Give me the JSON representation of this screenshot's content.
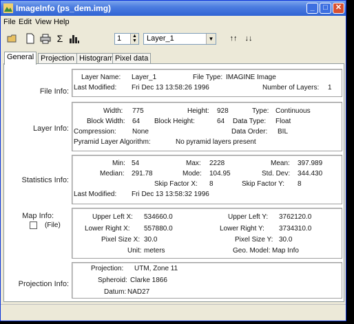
{
  "window": {
    "title": "ImageInfo (ps_dem.img)"
  },
  "menu": [
    "File",
    "Edit",
    "View",
    "Help"
  ],
  "toolbar": {
    "band_value": "1",
    "layer_selected": "Layer_1"
  },
  "tabs": [
    "General",
    "Projection",
    "Histogram",
    "Pixel data"
  ],
  "file_info": {
    "label": "File Info:",
    "layer_name_label": "Layer Name:",
    "layer_name": "Layer_1",
    "file_type_label": "File Type:",
    "file_type": "IMAGINE Image",
    "last_modified_label": "Last Modified:",
    "last_modified": "Fri Dec 13 13:58:26 1996",
    "num_layers_label": "Number of Layers:",
    "num_layers": "1"
  },
  "layer_info": {
    "label": "Layer Info:",
    "width_label": "Width:",
    "width": "775",
    "height_label": "Height:",
    "height": "928",
    "type_label": "Type:",
    "type": "Continuous",
    "block_width_label": "Block Width:",
    "block_width": "64",
    "block_height_label": "Block Height:",
    "block_height": "64",
    "data_type_label": "Data Type:",
    "data_type": "Float",
    "compression_label": "Compression:",
    "compression": "None",
    "data_order_label": "Data Order:",
    "data_order": "BIL",
    "pyramid_label": "Pyramid Layer Algorithm:",
    "pyramid": "No pyramid layers present"
  },
  "statistics_info": {
    "label": "Statistics Info:",
    "min_label": "Min:",
    "min": "54",
    "max_label": "Max:",
    "max": "2228",
    "mean_label": "Mean:",
    "mean": "397.989",
    "median_label": "Median:",
    "median": "291.78",
    "mode_label": "Mode:",
    "mode": "104.95",
    "stddev_label": "Std. Dev:",
    "stddev": "344.430",
    "skipx_label": "Skip Factor X:",
    "skipx": "8",
    "skipy_label": "Skip Factor Y:",
    "skipy": "8",
    "last_modified_label": "Last Modified:",
    "last_modified": "Fri Dec 13 13:58:32 1996"
  },
  "map_info": {
    "label": "Map Info:",
    "file_checkbox_label": "(File)",
    "upper_left_x_label": "Upper Left X:",
    "upper_left_x": "534660.0",
    "upper_left_y_label": "Upper Left Y:",
    "upper_left_y": "3762120.0",
    "lower_right_x_label": "Lower Right X:",
    "lower_right_x": "557880.0",
    "lower_right_y_label": "Lower Right Y:",
    "lower_right_y": "3734310.0",
    "pixel_size_x_label": "Pixel Size X:",
    "pixel_size_x": "30.0",
    "pixel_size_y_label": "Pixel Size Y:",
    "pixel_size_y": "30.0",
    "unit_label": "Unit:",
    "unit": "meters",
    "geo_model_label": "Geo. Model:",
    "geo_model": "Map Info"
  },
  "projection_info": {
    "label": "Projection Info:",
    "projection_label": "Projection:",
    "projection": "UTM, Zone 11",
    "spheroid_label": "Spheroid:",
    "spheroid": "Clarke 1866",
    "datum_label": "Datum:",
    "datum": "NAD27"
  }
}
